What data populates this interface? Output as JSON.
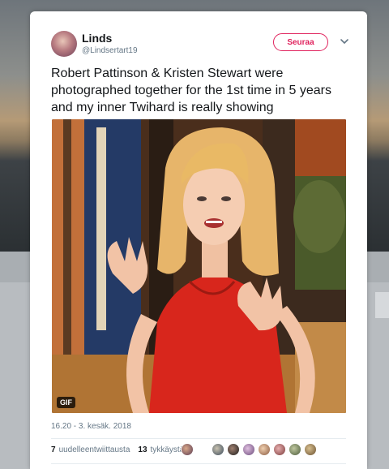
{
  "tweet": {
    "display_name": "Linds",
    "handle": "@Lindsertart19",
    "follow_label": "Seuraa",
    "text": "Robert Pattinson & Kristen Stewart were photographed together for the 1st time in 5 years and my inner Twihard is really showing",
    "media_badge": "GIF",
    "timestamp": "16.20 - 3. kesäk. 2018",
    "retweets_count": "7",
    "retweets_label": "uudelleentwiittausta",
    "likes_count": "13",
    "likes_label": "tykkäystä"
  },
  "colors": {
    "accent": "#e0245e",
    "muted": "#657786",
    "text": "#14171a"
  },
  "icons": {
    "caret": "chevron-down-icon"
  }
}
